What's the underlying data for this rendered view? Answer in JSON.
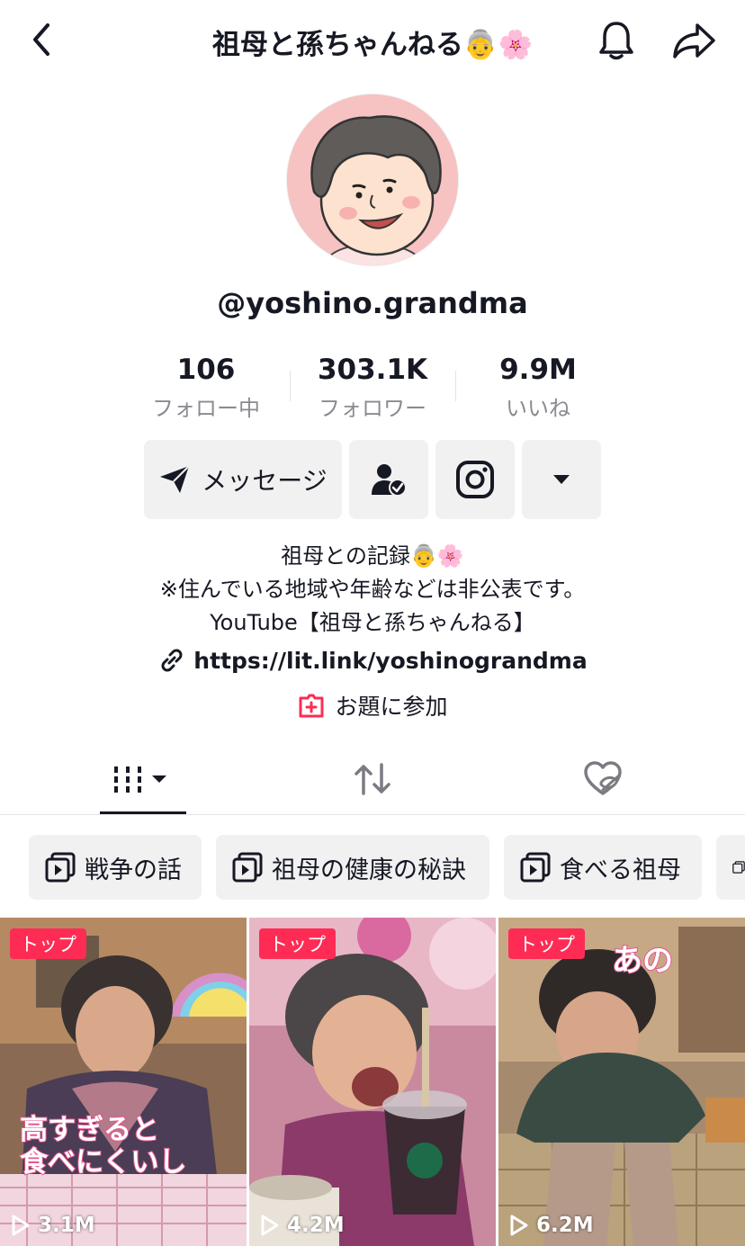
{
  "header": {
    "title": "祖母と孫ちゃんねる👵🌸"
  },
  "profile": {
    "username": "@yoshino.grandma",
    "stats": [
      {
        "value": "106",
        "label": "フォロー中"
      },
      {
        "value": "303.1K",
        "label": "フォロワー"
      },
      {
        "value": "9.9M",
        "label": "いいね"
      }
    ],
    "message_label": "メッセージ",
    "bio": [
      "祖母との記録👵🌸",
      "※住んでいる地域や年齢などは非公表です。",
      "YouTube【祖母と孫ちゃんねる】"
    ],
    "link": "https://lit.link/yoshinograndma",
    "topic_label": "お題に参加"
  },
  "playlists": [
    "戦争の話",
    "祖母の健康の秘訣",
    "食べる祖母"
  ],
  "videos": [
    {
      "badge": "トップ",
      "views": "3.1M",
      "overlay": [
        "高すぎると",
        "食べにくいし"
      ]
    },
    {
      "badge": "トップ",
      "views": "4.2M"
    },
    {
      "badge": "トップ",
      "views": "6.2M",
      "overlay": [
        "あの"
      ]
    }
  ],
  "colors": {
    "accent": "#fe2c55",
    "button_bg": "#f1f1f2",
    "muted_text": "#8a8b91",
    "avatar_bg": "#f6c2c2"
  }
}
